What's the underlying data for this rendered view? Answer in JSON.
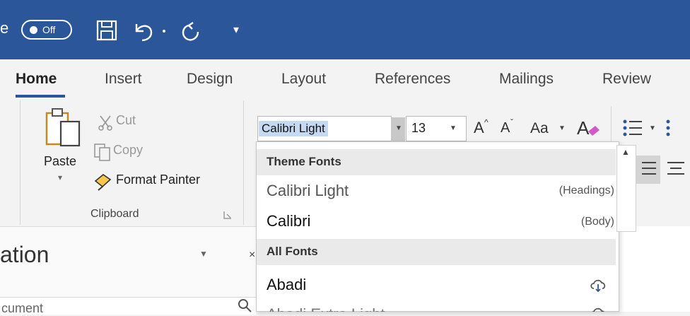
{
  "titlebar": {
    "autosave_prefix": "e",
    "toggle_label": "Off",
    "qat_more": "▾"
  },
  "tabs": [
    {
      "label": "Home"
    },
    {
      "label": "Insert"
    },
    {
      "label": "Design"
    },
    {
      "label": "Layout"
    },
    {
      "label": "References"
    },
    {
      "label": "Mailings"
    },
    {
      "label": "Review"
    }
  ],
  "clipboard": {
    "paste_label": "Paste",
    "paste_arrow": "▾",
    "cut_label": "Cut",
    "copy_label": "Copy",
    "format_painter_label": "Format Painter",
    "group_label": "Clipboard"
  },
  "font": {
    "name_value": "Calibri Light",
    "size_value": "13",
    "grow_label": "A",
    "shrink_label": "A",
    "change_case_label": "Aa"
  },
  "pane": {
    "title": "ation",
    "search_text": "cument"
  },
  "dropdown": {
    "theme_header": "Theme Fonts",
    "theme_items": [
      {
        "name": "Calibri Light",
        "note": "(Headings)"
      },
      {
        "name": "Calibri",
        "note": "(Body)"
      }
    ],
    "all_header": "All Fonts",
    "all_items": [
      {
        "name": "Abadi"
      },
      {
        "name": "Abadi Extra Light"
      }
    ]
  },
  "colors": {
    "titlebar": "#2b579a",
    "accent": "#2b579a",
    "selection": "#c5d9f3"
  },
  "icons": [
    "save-icon",
    "undo-icon",
    "redo-icon",
    "cut-icon",
    "copy-icon",
    "format-painter-icon",
    "paste-icon",
    "clear-formatting-icon",
    "bullets-icon",
    "cloud-download-icon"
  ]
}
